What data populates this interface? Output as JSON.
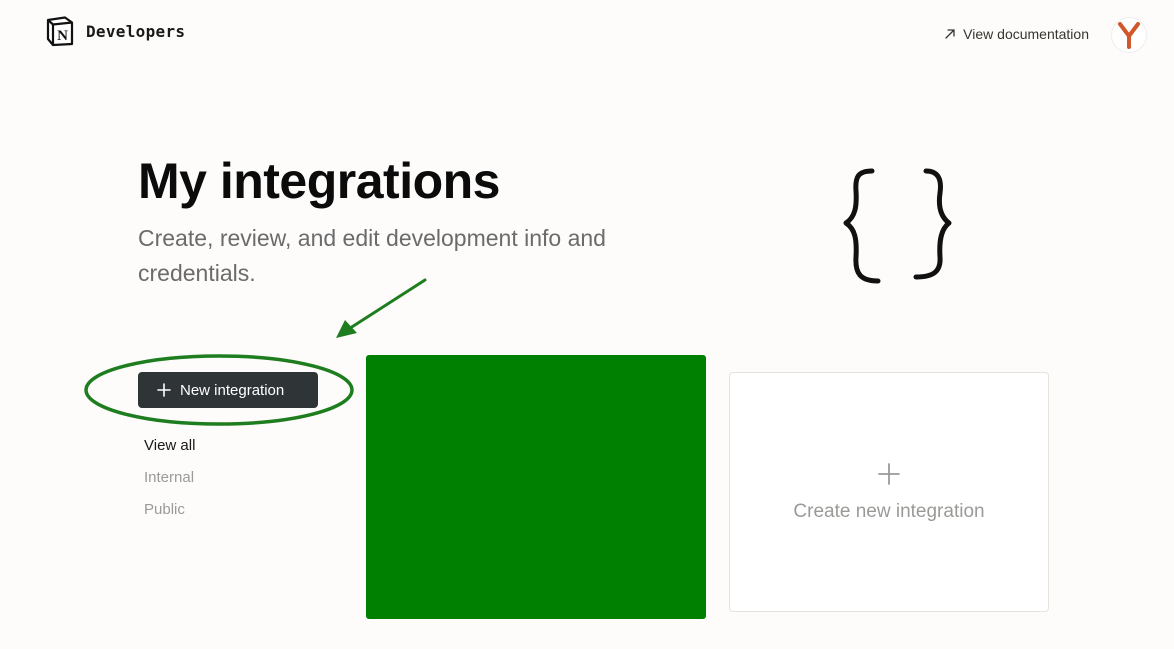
{
  "header": {
    "brand_name": "Developers",
    "doc_link_label": "View documentation",
    "avatar_initial": "Y"
  },
  "hero": {
    "title": "My integrations",
    "subtitle": "Create, review, and edit development info and credentials."
  },
  "sidebar": {
    "new_button_label": "New integration",
    "filters": [
      {
        "label": "View all",
        "active": true
      },
      {
        "label": "Internal",
        "active": false
      },
      {
        "label": "Public",
        "active": false
      }
    ]
  },
  "cards": {
    "create_label": "Create new integration"
  },
  "icons": {
    "brand": "notion-logo-icon",
    "doc_link": "arrow-up-right-icon",
    "new_button": "plus-icon",
    "create_card": "plus-icon",
    "hero_art": "curly-braces-icon"
  },
  "colors": {
    "page_background": "#fdfcfb",
    "primary_button": "#2f3437",
    "highlight_card": "#008000",
    "annotation": "#1e7d1e",
    "muted_text": "#9b9a97",
    "avatar_accent": "#d0582a"
  }
}
